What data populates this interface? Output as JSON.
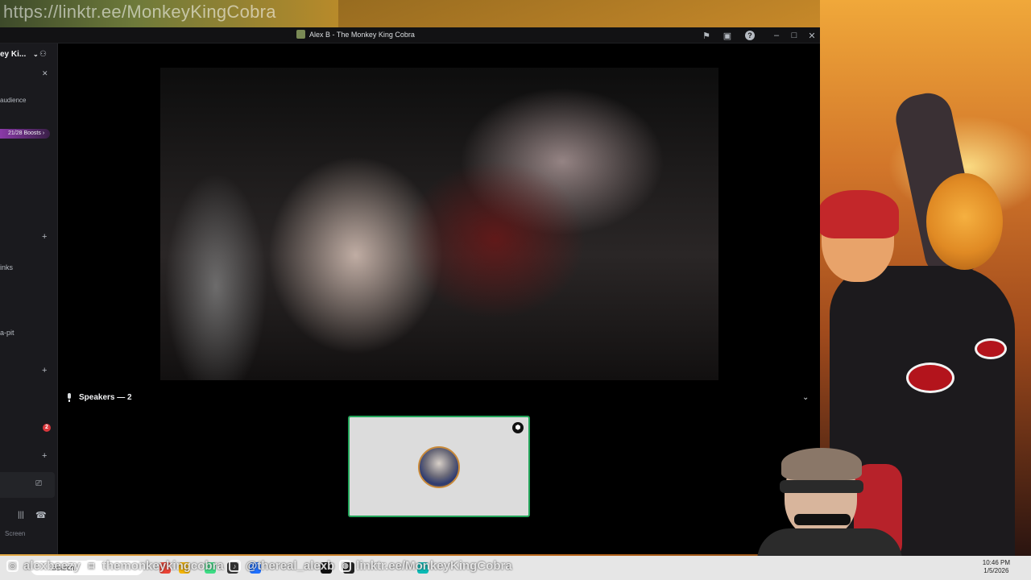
{
  "overlay": {
    "top_url": "https://linktr.ee/MonkeyKingCobra"
  },
  "window": {
    "title": "Alex B - The Monkey King Cobra",
    "controls": [
      "minimize",
      "maximize",
      "close"
    ]
  },
  "sidebar": {
    "server_name": "ey Ki...",
    "audience_text": "audience",
    "boost_pill": "21/28 Boosts",
    "channel_links": "inks",
    "channel_pit": "a-pit",
    "badge_count": "2",
    "screen_label": "Screen"
  },
  "main": {
    "speakers_header": "Speakers — 2"
  },
  "taskbar": {
    "search_placeholder": "Search",
    "clock_time": "10:46 PM",
    "clock_date": "1/5/2026"
  },
  "social_overlay": {
    "handle1": "alexbeezy",
    "handle2": "themonkeykingcobra",
    "handle3": "@thereal_alexb",
    "handle4": "linktr.ee/MonkeyKingCobra"
  },
  "colors": {
    "speaking_border": "#23a55a",
    "boost_accent": "#8a3aa8",
    "badge_red": "#da373c"
  }
}
